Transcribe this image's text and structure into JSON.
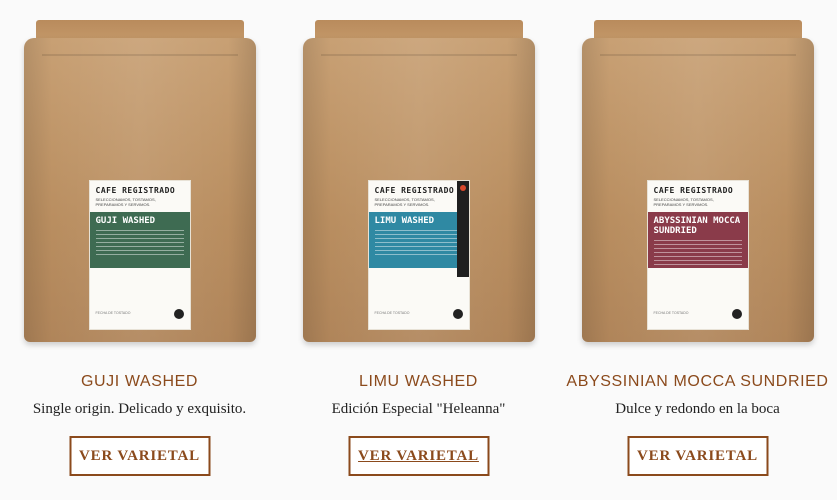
{
  "products": [
    {
      "name": "GUJI WASHED",
      "description": "Single origin. Delicado y exquisito.",
      "button": "VER VARIETAL",
      "label_brand": "CAFE REGISTRADO",
      "label_tagline": "SELECCIONAMOS, TOSTAMOS, PREPARAMOS Y SERVIMOS.",
      "label_name": "GUJI WASHED",
      "label_color": "#3e6b52",
      "label_footer": "FECHA DE TOSTADO",
      "special": false
    },
    {
      "name": "LIMU WASHED",
      "description": "Edición Especial \"Heleanna\"",
      "button": "VER VARIETAL",
      "label_brand": "CAFE REGISTRADO",
      "label_tagline": "SELECCIONAMOS, TOSTAMOS, PREPARAMOS Y SERVIMOS.",
      "label_name": "LIMU WASHED",
      "label_color": "#2f89a3",
      "label_footer": "FECHA DE TOSTADO",
      "special": true
    },
    {
      "name": "ABYSSINIAN MOCCA SUNDRIED",
      "description": "Dulce y redondo en la boca",
      "button": "VER VARIETAL",
      "label_brand": "CAFE REGISTRADO",
      "label_tagline": "SELECCIONAMOS, TOSTAMOS, PREPARAMOS Y SERVIMOS.",
      "label_name": "ABYSSINIAN MOCCA SUNDRIED",
      "label_color": "#8a3b4a",
      "label_footer": "FECHA DE TOSTADO",
      "special": false
    }
  ],
  "colors": {
    "accent": "#8b4a1c",
    "background": "#fafafa",
    "kraft": "#c29668"
  }
}
